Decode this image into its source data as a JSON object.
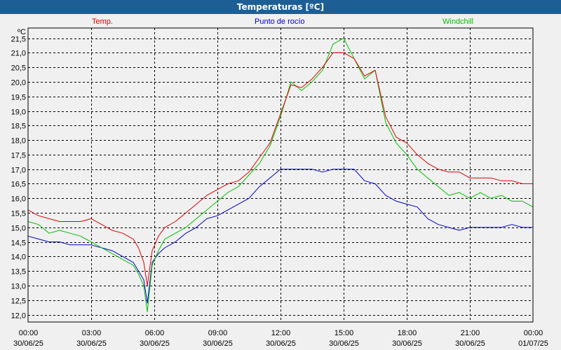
{
  "window": {
    "title": "Temperaturas [ºC]"
  },
  "colors": {
    "title_bar": "#1d5f95",
    "temp": "#e00000",
    "dew": "#0000c8",
    "windchill": "#00c000",
    "grid": "#000000",
    "background": "#f0f0f0"
  },
  "chart_data": {
    "type": "line",
    "title": "Temperaturas [ºC]",
    "ylabel": "ºC",
    "ylim": [
      11.75,
      21.85
    ],
    "xlim": [
      0,
      24
    ],
    "grid": true,
    "legend_position": "top",
    "y_ticks": [
      "12,0",
      "12,5",
      "13,0",
      "13,5",
      "14,0",
      "14,5",
      "15,0",
      "15,5",
      "16,0",
      "16,5",
      "17,0",
      "17,5",
      "18,0",
      "18,5",
      "19,0",
      "19,5",
      "20,0",
      "20,5",
      "21,0",
      "21,5"
    ],
    "x_ticks": [
      {
        "time": "00:00",
        "date": "30/06/25"
      },
      {
        "time": "03:00",
        "date": "30/06/25"
      },
      {
        "time": "06:00",
        "date": "30/06/25"
      },
      {
        "time": "09:00",
        "date": "30/06/25"
      },
      {
        "time": "12:00",
        "date": "30/06/25"
      },
      {
        "time": "15:00",
        "date": "30/06/25"
      },
      {
        "time": "18:00",
        "date": "30/06/25"
      },
      {
        "time": "21:00",
        "date": "30/06/25"
      },
      {
        "time": "00:00",
        "date": "01/07/25"
      }
    ],
    "x_hours": [
      0,
      0.5,
      1,
      1.5,
      2,
      2.5,
      3,
      3.5,
      4,
      4.5,
      5,
      5.25,
      5.5,
      5.67,
      5.9,
      6.2,
      6.5,
      7,
      7.5,
      8,
      8.5,
      9,
      9.5,
      10,
      10.5,
      11,
      11.5,
      12,
      12.5,
      13,
      13.5,
      14,
      14.5,
      15,
      15.5,
      16,
      16.5,
      17,
      17.5,
      18,
      18.5,
      19,
      19.5,
      20,
      20.5,
      21,
      21.5,
      22,
      22.5,
      23,
      23.5,
      24
    ],
    "series": [
      {
        "name": "Temp.",
        "color": "#e00000",
        "values": [
          15.6,
          15.4,
          15.3,
          15.2,
          15.2,
          15.2,
          15.3,
          15.1,
          14.9,
          14.8,
          14.6,
          14.3,
          13.8,
          13.0,
          14.2,
          14.7,
          15.0,
          15.2,
          15.5,
          15.8,
          16.1,
          16.3,
          16.5,
          16.6,
          16.9,
          17.4,
          17.9,
          18.9,
          19.9,
          19.8,
          20.1,
          20.5,
          21.0,
          21.0,
          20.8,
          20.2,
          20.4,
          18.8,
          18.1,
          17.9,
          17.5,
          17.2,
          17.0,
          16.9,
          16.9,
          16.7,
          16.7,
          16.7,
          16.6,
          16.6,
          16.5,
          16.5
        ]
      },
      {
        "name": "Punto de rocío",
        "color": "#0000c8",
        "values": [
          14.7,
          14.6,
          14.5,
          14.5,
          14.4,
          14.4,
          14.4,
          14.3,
          14.2,
          14.0,
          13.8,
          13.5,
          13.2,
          12.4,
          13.8,
          14.1,
          14.3,
          14.5,
          14.8,
          15.0,
          15.3,
          15.4,
          15.6,
          15.8,
          16.0,
          16.4,
          16.7,
          17.0,
          17.0,
          17.0,
          17.0,
          16.9,
          17.0,
          17.0,
          17.0,
          16.6,
          16.5,
          16.1,
          15.9,
          15.8,
          15.7,
          15.3,
          15.1,
          15.0,
          14.9,
          15.0,
          15.0,
          15.0,
          15.0,
          15.1,
          15.0,
          15.0
        ]
      },
      {
        "name": "Windchill",
        "color": "#00c000",
        "values": [
          15.2,
          15.1,
          14.8,
          14.9,
          14.8,
          14.7,
          14.5,
          14.3,
          14.1,
          13.9,
          13.7,
          13.4,
          13.0,
          12.1,
          13.7,
          14.2,
          14.6,
          14.8,
          15.0,
          15.3,
          15.6,
          15.9,
          16.2,
          16.4,
          16.8,
          17.2,
          17.8,
          18.8,
          20.0,
          19.7,
          20.0,
          20.4,
          21.3,
          21.5,
          20.8,
          20.1,
          20.4,
          18.6,
          17.9,
          17.5,
          17.0,
          16.7,
          16.4,
          16.1,
          16.2,
          16.0,
          16.2,
          16.0,
          16.1,
          15.9,
          15.9,
          15.7
        ]
      }
    ]
  }
}
